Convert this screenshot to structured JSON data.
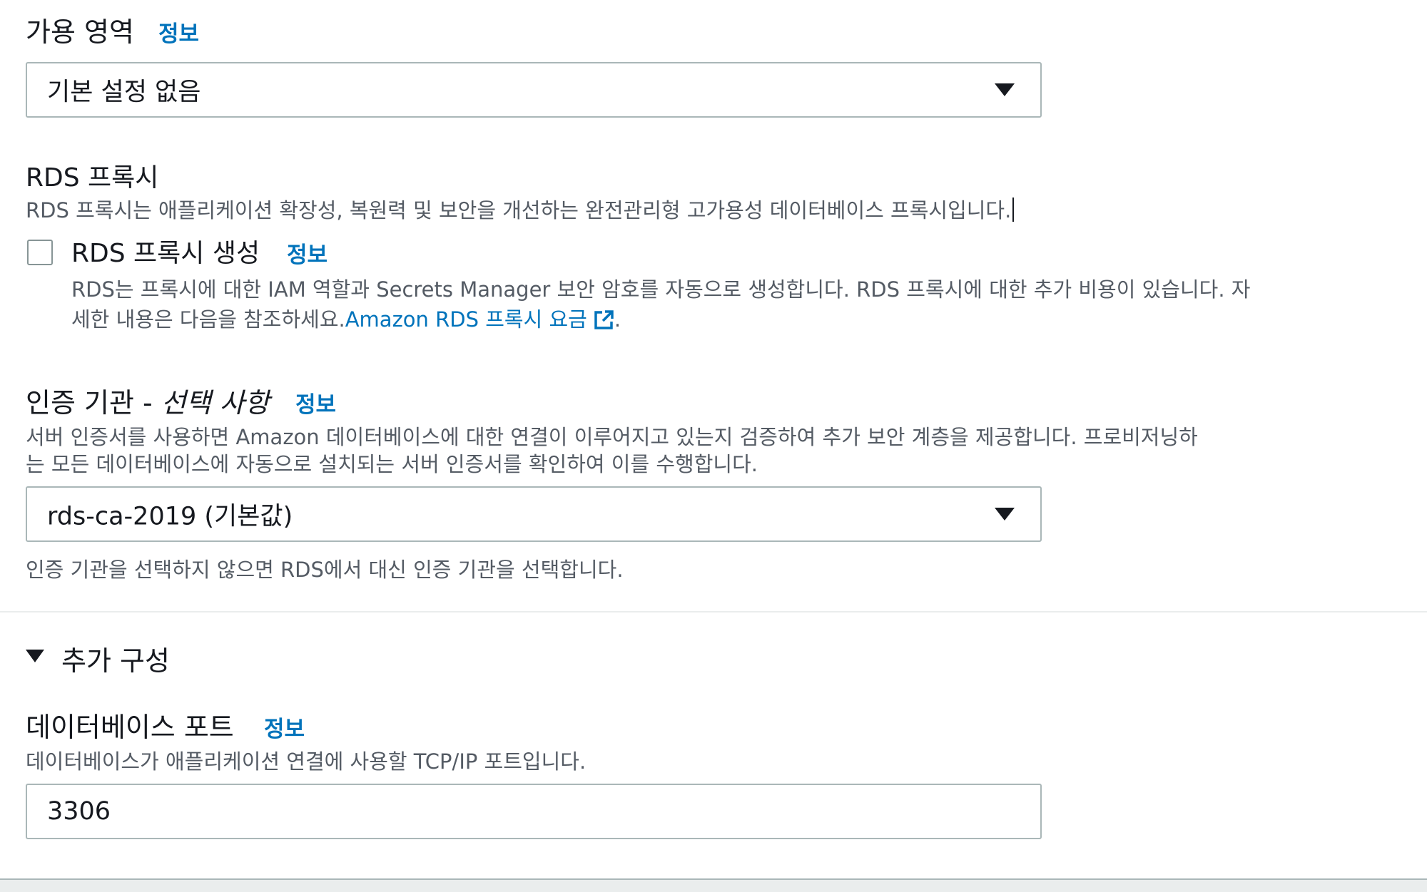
{
  "availability_zone": {
    "label": "가용 영역",
    "info": "정보",
    "selected": "기본 설정 없음"
  },
  "rds_proxy": {
    "heading": "RDS 프록시",
    "description": "RDS 프록시는 애플리케이션 확장성, 복원력 및 보안을 개선하는 완전관리형 고가용성 데이터베이스 프록시입니다.",
    "checkbox_label": "RDS 프록시 생성",
    "checkbox_checked": false,
    "info": "정보",
    "detail_line1": "RDS는 프록시에 대한 IAM 역할과 Secrets Manager 보안 암호를 자동으로 생성합니다. RDS 프록시에 대한 추가 비용이 있습니다. 자",
    "detail_line2": "세한 내용은 다음을 참조하세요.",
    "link_text": "Amazon RDS 프록시 요금",
    "link_suffix": ".",
    "link_icon": "external-link-icon"
  },
  "certificate_authority": {
    "label": "인증 기관 - ",
    "optional": "선택 사항",
    "info": "정보",
    "description_line1": "서버 인증서를 사용하면 Amazon 데이터베이스에 대한 연결이 이루어지고 있는지 검증하여 추가 보안 계층을 제공합니다. 프로비저닝하",
    "description_line2": "는 모든 데이터베이스에 자동으로 설치되는 서버 인증서를 확인하여 이를 수행합니다.",
    "selected": "rds-ca-2019 (기본값)",
    "hint": "인증 기관을 선택하지 않으면 RDS에서 대신 인증 기관을 선택합니다."
  },
  "additional_config": {
    "title": "추가 구성",
    "expanded": true
  },
  "database_port": {
    "label": "데이터베이스 포트",
    "info": "정보",
    "description": "데이터베이스가 애플리케이션 연결에 사용할 TCP/IP 포트입니다.",
    "value": "3306"
  }
}
